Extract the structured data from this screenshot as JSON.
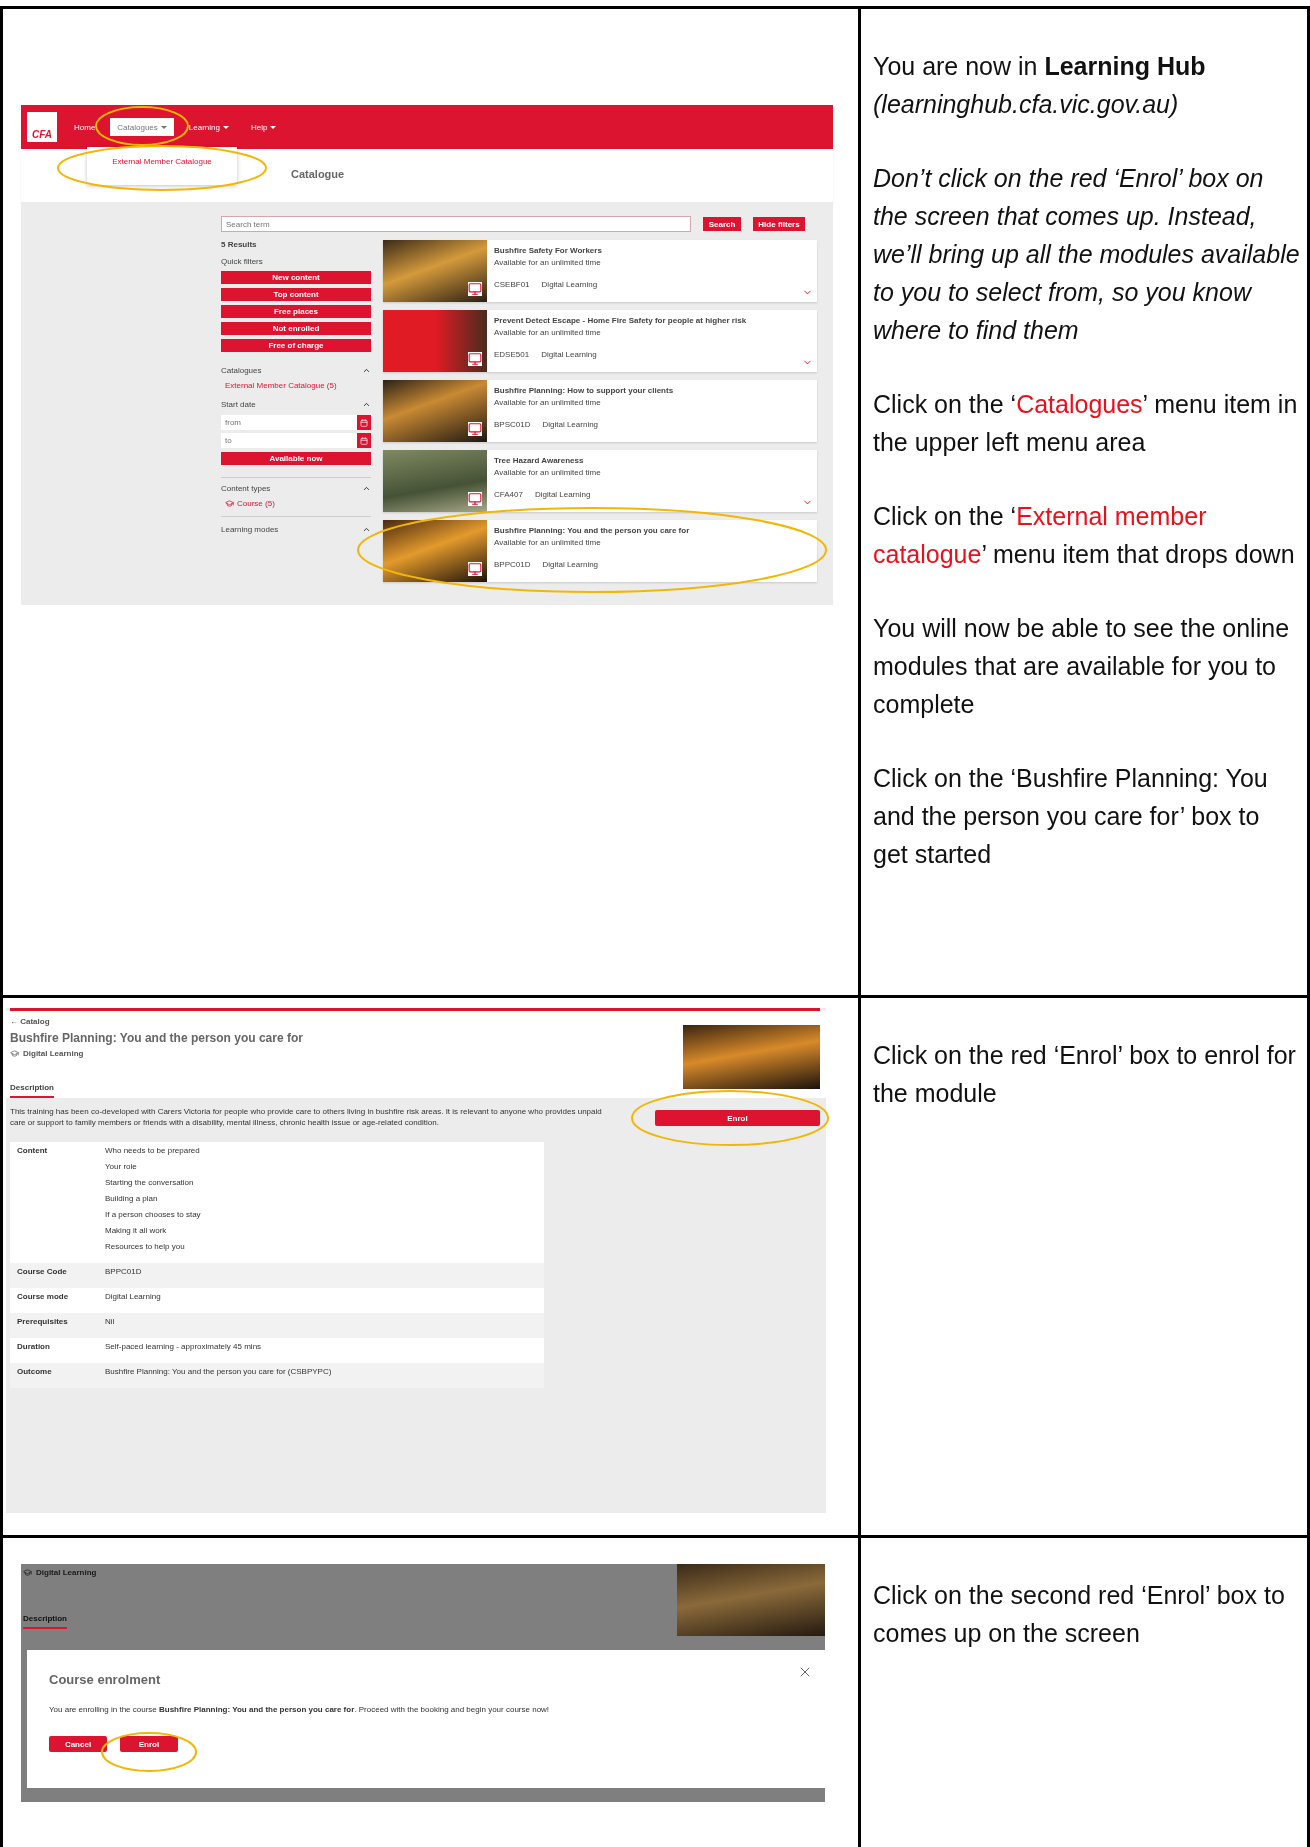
{
  "steps": [
    {
      "screen": {
        "kind": "catalogue",
        "logo": "CFA",
        "nav": [
          {
            "label": "Home",
            "selected": false
          },
          {
            "label": "Catalogues",
            "selected": true
          },
          {
            "label": "Learning",
            "selected": false
          },
          {
            "label": "Help",
            "selected": false
          }
        ],
        "dropdown_item": "External Member Catalogue",
        "page_title": "Catalogue",
        "search": {
          "placeholder": "Search term"
        },
        "search_button": "Search",
        "hide_filters_button": "Hide filters",
        "results_count": "5 Results",
        "quick_filters": {
          "title": "Quick filters",
          "buttons": [
            "New content",
            "Top content",
            "Free places",
            "Not enrolled",
            "Free of charge"
          ]
        },
        "catalogues_filter": {
          "title": "Catalogues",
          "item": "External Member Catalogue  (5)"
        },
        "start_date_filter": {
          "title": "Start date",
          "from_placeholder": "from",
          "to_placeholder": "to",
          "button": "Available now"
        },
        "content_types_filter": {
          "title": "Content types",
          "item": "Course  (5)"
        },
        "learning_modes_filter": {
          "title": "Learning modes"
        },
        "courses": [
          {
            "title": "Bushfire Safety For Workers",
            "availability": "Available for an unlimited time",
            "code": "CSEBF01",
            "mode": "Digital Learning",
            "expandable": true
          },
          {
            "title": "Prevent Detect Escape - Home Fire Safety for people at higher risk",
            "availability": "Available for an unlimited time",
            "code": "EDSE501",
            "mode": "Digital Learning",
            "expandable": true
          },
          {
            "title": "Bushfire Planning: How to support your clients",
            "availability": "Available for an unlimited time",
            "code": "BPSC01D",
            "mode": "Digital Learning",
            "expandable": false
          },
          {
            "title": "Tree Hazard Awareness",
            "availability": "Available for an unlimited time",
            "code": "CFA407",
            "mode": "Digital Learning",
            "expandable": true
          },
          {
            "title": "Bushfire Planning: You and the person you care for",
            "availability": "Available for an unlimited time",
            "code": "BPPC01D",
            "mode": "Digital Learning",
            "expandable": false
          }
        ]
      },
      "instructions": [
        {
          "italic": false,
          "segments": [
            {
              "kind": "plain",
              "text": "You are now in "
            },
            {
              "kind": "bold",
              "text": "Learning Hub"
            },
            {
              "kind": "link",
              "text": "(learninghub.cfa.vic.gov.au)"
            }
          ]
        },
        {
          "italic": true,
          "segments": [
            {
              "kind": "plain",
              "text": "Don’t click on the red ‘Enrol’ box on the screen that comes up. Instead, we’ll bring up all the modules available to you to select from, so you know where to find them"
            }
          ]
        },
        {
          "italic": false,
          "segments": [
            {
              "kind": "plain",
              "text": "Click on the ‘"
            },
            {
              "kind": "red",
              "text": "Catalogues"
            },
            {
              "kind": "plain",
              "text": "’ menu item in the upper left menu area"
            }
          ]
        },
        {
          "italic": false,
          "segments": [
            {
              "kind": "plain",
              "text": "Click on the ‘"
            },
            {
              "kind": "red",
              "text": "External member catalogue"
            },
            {
              "kind": "plain",
              "text": "’ menu item that drops down"
            }
          ]
        },
        {
          "italic": false,
          "segments": [
            {
              "kind": "plain",
              "text": "You will now be able to see the online modules that are available for you to complete"
            }
          ]
        },
        {
          "italic": false,
          "segments": [
            {
              "kind": "plain",
              "text": "Click on the ‘Bushfire Planning: You and the person you care for’ box to get started"
            }
          ]
        }
      ]
    },
    {
      "screen": {
        "kind": "course_detail",
        "back_link": "← Catalog",
        "title": "Bushfire Planning: You and the person you care for",
        "mode": "Digital Learning",
        "tabs": [
          {
            "label": "Description",
            "selected": true
          }
        ],
        "description": "This training has been co-developed with Carers Victoria for people who provide care to others living in bushfire risk areas. It is relevant to anyone who provides unpaid care or support to family members or friends with a disability, mental illness, chronic health issue or age-related condition.",
        "enrol_button": "Enrol",
        "details": [
          {
            "label": "Content",
            "values": [
              "Who needs to be prepared",
              "Your role",
              "Starting the conversation",
              "Building a plan",
              "If a person chooses to stay",
              "Making it all work",
              "Resources to help you"
            ]
          },
          {
            "label": "Course Code",
            "values": [
              "BPPC01D"
            ]
          },
          {
            "label": "Course mode",
            "values": [
              "Digital Learning"
            ]
          },
          {
            "label": "Prerequisites",
            "values": [
              "Nil"
            ]
          },
          {
            "label": "Duration",
            "values": [
              "Self-paced learning - approximately 45 mins"
            ]
          },
          {
            "label": "Outcome",
            "values": [
              "Bushfire Planning: You and the person you care for (CSBPYPC)"
            ]
          }
        ]
      },
      "instructions": [
        {
          "italic": false,
          "segments": [
            {
              "kind": "plain",
              "text": "Click on the red ‘Enrol’ box to enrol for the module"
            }
          ]
        }
      ]
    },
    {
      "screen": {
        "kind": "enrol_dialog",
        "mode": "Digital Learning",
        "tabs": [
          {
            "label": "Description",
            "selected": true
          }
        ],
        "dialog": {
          "title": "Course enrolment",
          "message": "You are enrolling in the course **Bushfire Planning: You and the person you care for**. Proceed with the booking and begin your course now!",
          "buttons": [
            "Cancel",
            "Enrol"
          ]
        }
      },
      "instructions": [
        {
          "italic": false,
          "segments": [
            {
              "kind": "plain",
              "text": "Click on the second red ‘Enrol’ box to comes up on the screen"
            }
          ]
        }
      ]
    }
  ]
}
